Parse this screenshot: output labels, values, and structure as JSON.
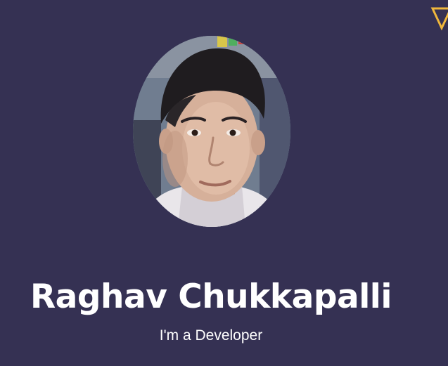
{
  "profile": {
    "name": "Raghav Chukkapalli",
    "tagline": "I'm a Developer",
    "photo_alt": "Profile photo of Raghav Chukkapalli"
  },
  "decorations": {
    "corner_icon": "triangle-down-outline-icon"
  },
  "colors": {
    "background": "#353153",
    "text": "#ffffff",
    "accent": "#f0b73c"
  }
}
